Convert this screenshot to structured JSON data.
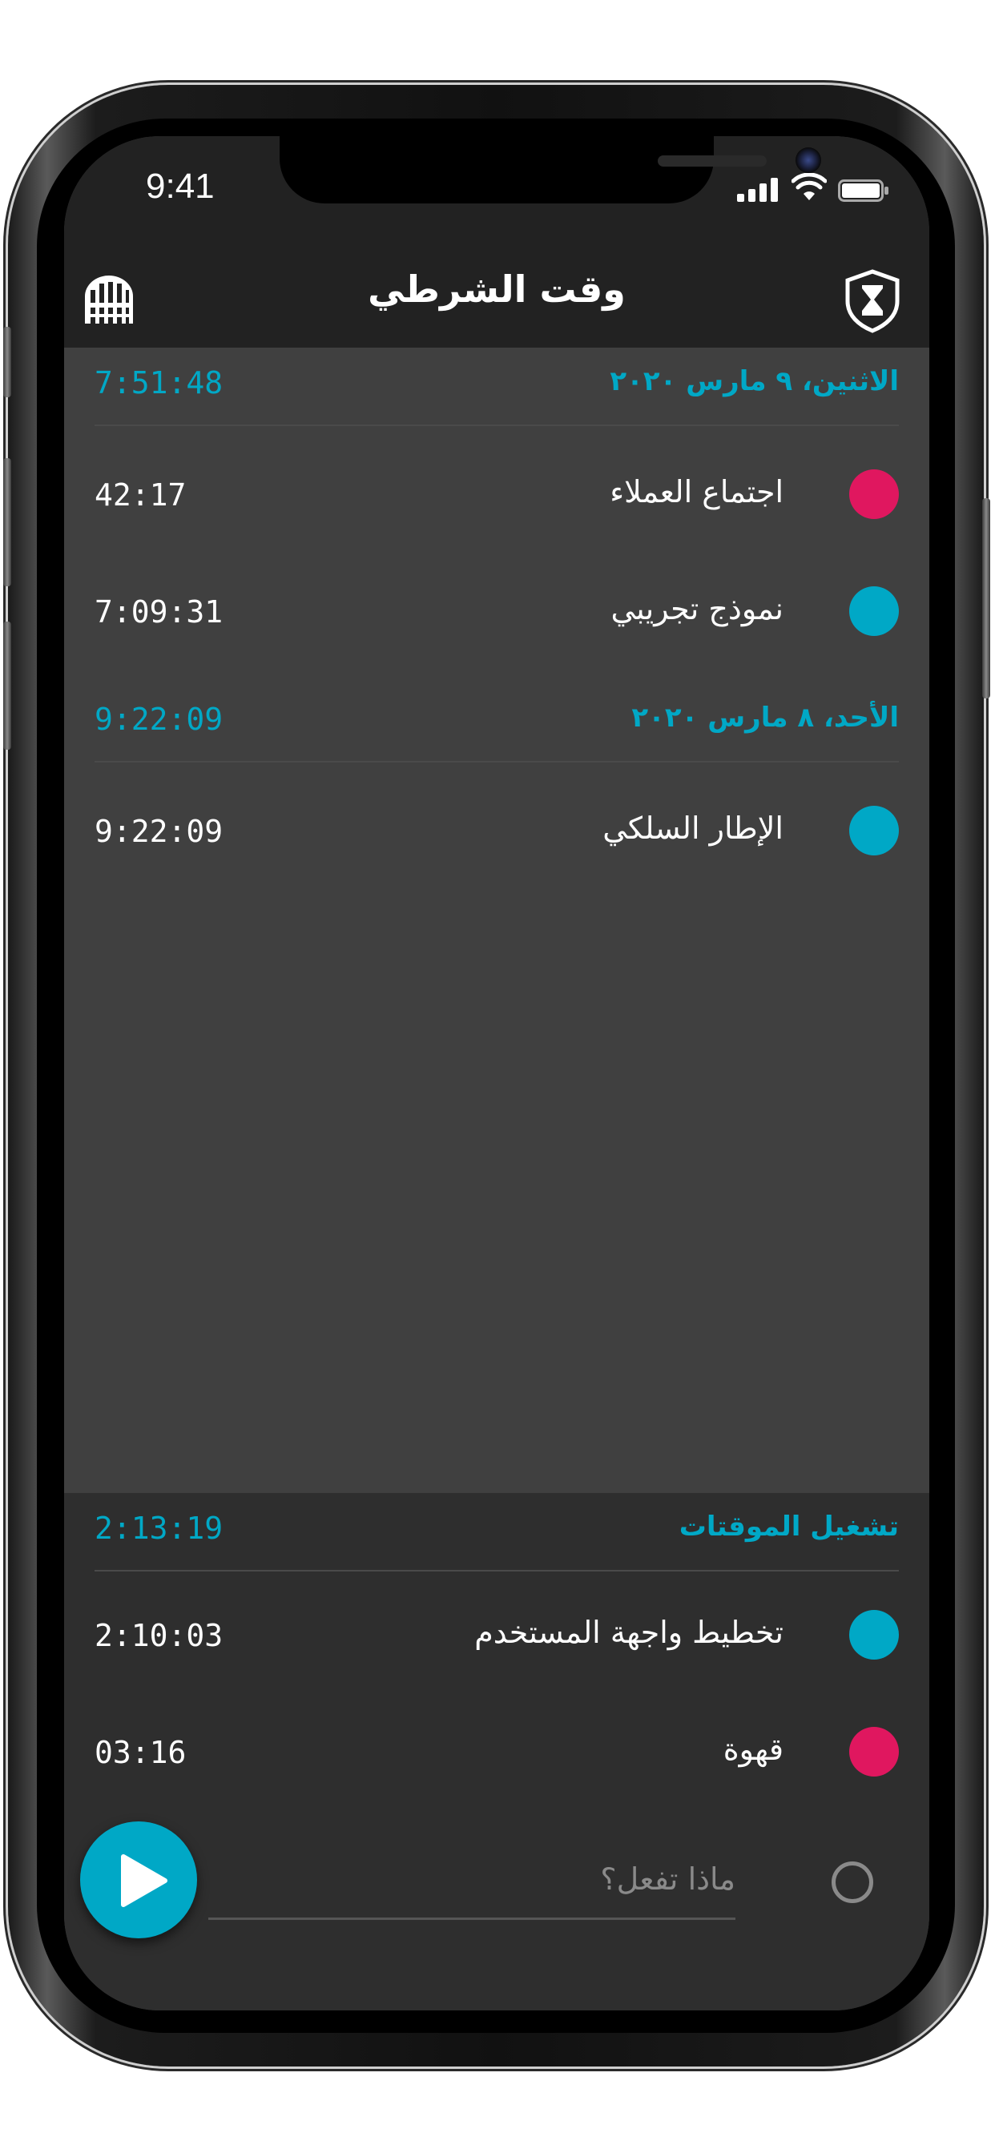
{
  "status_bar": {
    "time": "9:41"
  },
  "nav": {
    "title": "وقت الشرطي",
    "left_icon": "gate-icon",
    "right_icon": "shield-hourglass-icon"
  },
  "colors": {
    "accent": "#00a8c6",
    "pink": "#e0175f",
    "teal": "#00a8c6",
    "bg": "#404040",
    "nav_bg": "#222222",
    "running_bg": "#2e2e2e"
  },
  "days": [
    {
      "title": "الاثنين، ٩ مارس ٢٠٢٠",
      "total": "7:51:48",
      "entries": [
        {
          "label": "اجتماع العملاء",
          "duration": "42:17",
          "color": "#e0175f"
        },
        {
          "label": "نموذج تجريبي",
          "duration": "7:09:31",
          "color": "#00a8c6"
        }
      ]
    },
    {
      "title": "الأحد، ٨ مارس ٢٠٢٠",
      "total": "9:22:09",
      "entries": [
        {
          "label": "الإطار السلكي",
          "duration": "9:22:09",
          "color": "#00a8c6"
        }
      ]
    }
  ],
  "running": {
    "title": "تشغيل الموقتات",
    "total": "2:13:19",
    "entries": [
      {
        "label": "تخطيط واجهة المستخدم",
        "duration": "2:10:03",
        "color": "#00a8c6"
      },
      {
        "label": "قهوة",
        "duration": "03:16",
        "color": "#e0175f"
      }
    ]
  },
  "composer": {
    "placeholder": "ماذا تفعل؟",
    "play_icon": "play-icon"
  }
}
